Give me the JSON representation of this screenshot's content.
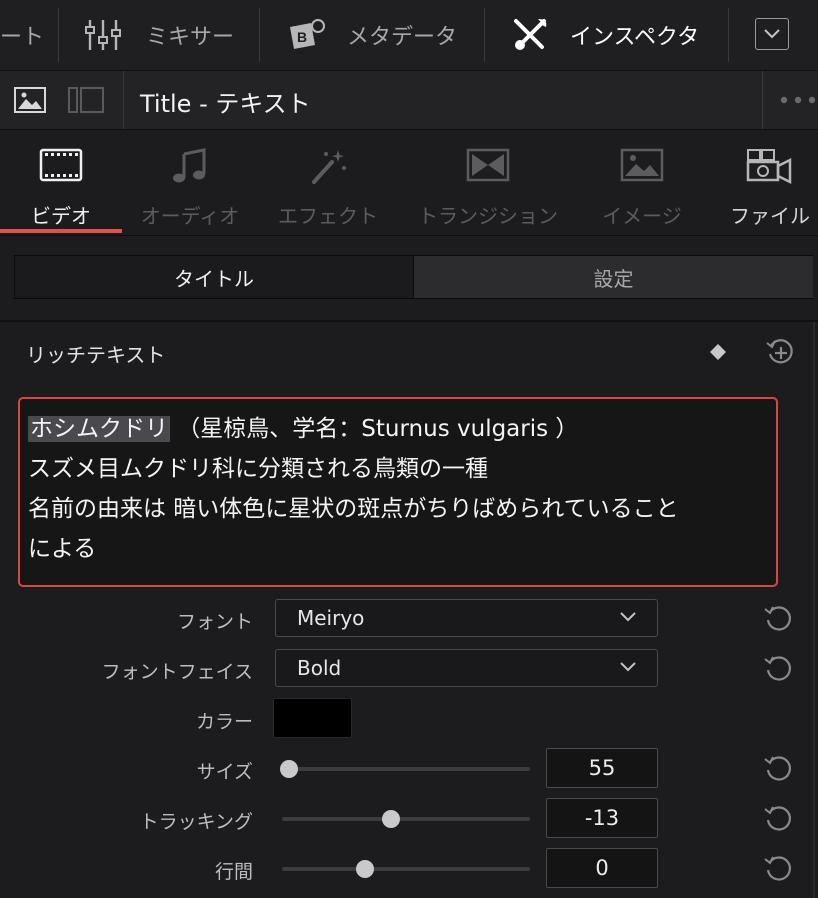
{
  "toolbar": {
    "partial_label": "ート",
    "mixer_label": "ミキサー",
    "metadata_label": "メタデータ",
    "inspector_label": "インスペクタ"
  },
  "title_row": {
    "title": "Title - テキスト"
  },
  "category_tabs": [
    {
      "label": "ビデオ",
      "icon": "film-icon",
      "active": true
    },
    {
      "label": "オーディオ",
      "icon": "music-note-icon",
      "active": false
    },
    {
      "label": "エフェクト",
      "icon": "magic-wand-icon",
      "active": false
    },
    {
      "label": "トランジション",
      "icon": "transition-icon",
      "active": false
    },
    {
      "label": "イメージ",
      "icon": "image-icon",
      "active": false
    },
    {
      "label": "ファイル",
      "icon": "film-camera-icon",
      "active": false
    }
  ],
  "segments": {
    "title_tab": "タイトル",
    "settings_tab": "設定"
  },
  "rich_text": {
    "section_label": "リッチテキスト",
    "selected_word": "ホシムクドリ",
    "line1_rest": " （星椋鳥、学名：Sturnus vulgaris ）",
    "line2": "スズメ目ムクドリ科に分類される鳥類の一種",
    "line3": "名前の由来は 暗い体色に星状の斑点がちりばめられていること",
    "line4": "による"
  },
  "properties": {
    "font_label": "フォント",
    "font_value": "Meiryo",
    "face_label": "フォントフェイス",
    "face_value": "Bold",
    "color_label": "カラー",
    "color_value": "#000000",
    "size_label": "サイズ",
    "size_value": "55",
    "tracking_label": "トラッキング",
    "tracking_value": "-13",
    "spacing_label": "行間",
    "spacing_value": "0"
  },
  "colors": {
    "accent": "#e0534a",
    "highlight_border": "#d9473e"
  }
}
